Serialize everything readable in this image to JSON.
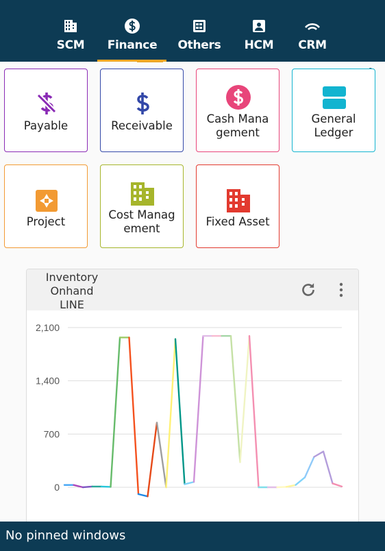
{
  "nav": {
    "tabs": [
      {
        "label": "SCM",
        "icon": "building-icon"
      },
      {
        "label": "Finance",
        "icon": "dollar-circle-icon",
        "active": true
      },
      {
        "label": "Others",
        "icon": "grid-doc-icon"
      },
      {
        "label": "HCM",
        "icon": "id-badge-icon"
      },
      {
        "label": "CRM",
        "icon": "signal-arc-icon"
      }
    ],
    "accent": "#f0a726",
    "background": "#0d3b54"
  },
  "tiles": [
    {
      "label_lines": [
        "Payable"
      ],
      "icon": "dollar-strikethrough-icon",
      "color": "#8a2ab5"
    },
    {
      "label_lines": [
        "Receivable"
      ],
      "icon": "dollar-icon",
      "color": "#3348a8"
    },
    {
      "label_lines": [
        "Cash Mana",
        "gement"
      ],
      "icon": "dollar-circle-icon",
      "color": "#e8457a"
    },
    {
      "label_lines": [
        "General",
        "Ledger"
      ],
      "icon": "ledger-icon",
      "color": "#12b4d0"
    },
    {
      "label_lines": [
        "Project"
      ],
      "icon": "project-icon",
      "color": "#f29a33"
    },
    {
      "label_lines": [
        "Cost Manag",
        "ement"
      ],
      "icon": "building-icon",
      "color": "#a6b52b"
    },
    {
      "label_lines": [
        "Fixed Asset"
      ],
      "icon": "building-icon",
      "color": "#e23a2f"
    }
  ],
  "widget": {
    "title_lines": [
      "Inventory",
      "Onhand",
      "LINE"
    ],
    "refresh_icon": "refresh-icon",
    "menu_icon": "more-vertical-icon"
  },
  "chart_data": {
    "type": "line",
    "title": "Inventory Onhand LINE",
    "xlabel": "",
    "ylabel": "",
    "ylim": [
      0,
      2100
    ],
    "yticks": [
      "0",
      "700",
      "1,400",
      "2,100"
    ],
    "grid": true,
    "values": [
      30,
      30,
      0,
      10,
      10,
      5,
      1970,
      1970,
      -90,
      -120,
      850,
      0,
      1950,
      40,
      70,
      1990,
      1990,
      1990,
      1990,
      330,
      1990,
      0,
      0,
      0,
      5,
      30,
      130,
      400,
      470,
      50,
      10
    ],
    "segment_colors": [
      "#42a5f5",
      "#ab47bc",
      "#7e57c2",
      "#26a69a",
      "#26c6da",
      "#66bb6a",
      "#9ccc65",
      "#f4511e",
      "#1e88e5",
      "#e64a19",
      "#9e9e9e",
      "#fff176",
      "#009688",
      "#81d4fa",
      "#ce93d8",
      "#e1bee7",
      "#f8bbd0",
      "#a5d6a7",
      "#c5e1a5",
      "#f0f4c3",
      "#f48fb1",
      "#80deea",
      "#e1bee7",
      "#fff9c4",
      "#fff59d",
      "#81d4fa",
      "#90caf9",
      "#b39ddb",
      "#b39ddb",
      "#f48fb1"
    ]
  },
  "footer": {
    "text": "No pinned windows"
  }
}
